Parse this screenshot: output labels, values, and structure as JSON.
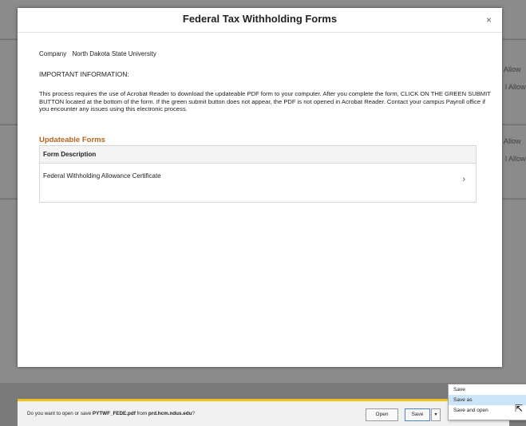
{
  "background": {
    "fragments": [
      "Allow",
      "l Allow",
      "Allow",
      "l Allow"
    ]
  },
  "modal": {
    "title": "Federal Tax Withholding Forms",
    "close_label": "×",
    "company_label": "Company",
    "company_value": "North Dakota State University",
    "important_heading": "IMPORTANT INFORMATION:",
    "paragraph": "This process requires the use of Acrobat Reader to download the updateable PDF form to your computer.  After you complete the form, CLICK ON THE GREEN SUBMIT BUTTON located at the bottom of the form.  If the green submit button does not appear, the PDF is not opened in Acrobat Reader. Contact your campus Payroll office if you encounter any issues using this electronic process.",
    "section_title": "Updateable Forms",
    "table": {
      "column_header": "Form Description",
      "rows": [
        "Federal Withholding Allowance Certificate"
      ]
    }
  },
  "download_bar": {
    "prompt_prefix": "Do you want to open or save ",
    "file_name": "PYTWF_FEDE.pdf",
    "prompt_middle": " from ",
    "host": "prd.hcm.ndus.edu",
    "prompt_suffix": "?",
    "open_label": "Open",
    "save_label": "Save",
    "arrow_label": "▾",
    "close_label": "×"
  },
  "save_menu": {
    "items": [
      "Save",
      "Save as",
      "Save and open"
    ],
    "highlighted_index": 1
  },
  "colors": {
    "section_title": "#b5651d",
    "download_bar_accent": "#f2c11c",
    "menu_highlight": "#cce4f7"
  }
}
